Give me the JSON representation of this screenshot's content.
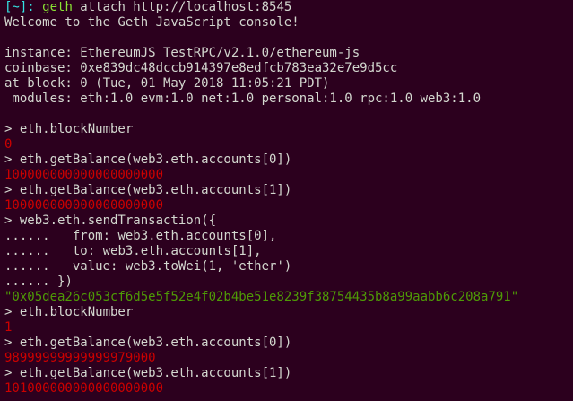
{
  "theme": {
    "background": "#2c001e",
    "text": "#d3d7cf",
    "number_output": "#cc0000",
    "string_output": "#4e9a06",
    "shell_prompt": "#34e2e2",
    "shell_command": "#8ae234"
  },
  "shell": {
    "prompt": "[~]:",
    "command": "geth",
    "args": " attach http://localhost:8545"
  },
  "banner": {
    "welcome": "Welcome to the Geth JavaScript console!",
    "instance": "instance: EthereumJS TestRPC/v2.1.0/ethereum-js",
    "coinbase": "coinbase: 0xe839dc48dccb914397e8edfcb783ea32e7e9d5cc",
    "at_block": "at block: 0 (Tue, 01 May 2018 11:05:21 PDT)",
    "modules": " modules: eth:1.0 evm:1.0 net:1.0 personal:1.0 rpc:1.0 web3:1.0"
  },
  "session": {
    "prompt": "> ",
    "continuation": "...... ",
    "cmd_block_number_1": "eth.blockNumber",
    "out_block_number_1": "0",
    "cmd_balance_0_a": "eth.getBalance(web3.eth.accounts[0])",
    "out_balance_0_a": "100000000000000000000",
    "cmd_balance_1_a": "eth.getBalance(web3.eth.accounts[1])",
    "out_balance_1_a": "100000000000000000000",
    "cmd_send_tx": "web3.eth.sendTransaction({",
    "cont_from": "  from: web3.eth.accounts[0],",
    "cont_to": "  to: web3.eth.accounts[1],",
    "cont_value": "  value: web3.toWei(1, 'ether')",
    "cont_close": "})",
    "out_tx_hash": "\"0x05dea26c053cf6d5e5f52e4f02b4be51e8239f38754435b8a99aabb6c208a791\"",
    "cmd_block_number_2": "eth.blockNumber",
    "out_block_number_2": "1",
    "cmd_balance_0_b": "eth.getBalance(web3.eth.accounts[0])",
    "out_balance_0_b": "98999999999999979000",
    "cmd_balance_1_b": "eth.getBalance(web3.eth.accounts[1])",
    "out_balance_1_b": "101000000000000000000"
  }
}
